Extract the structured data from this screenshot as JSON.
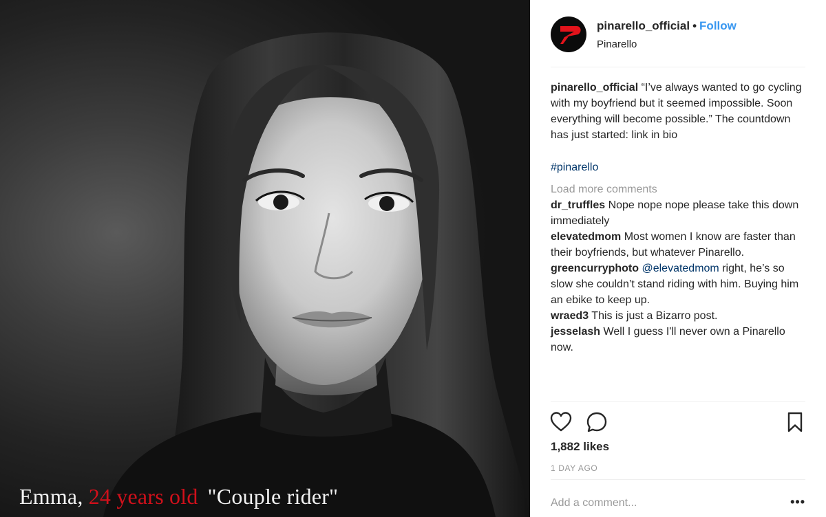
{
  "photo": {
    "caption_name": "Emma,",
    "caption_age": "24 years old",
    "caption_label": "\"Couple rider\""
  },
  "header": {
    "username": "pinarello_official",
    "dot": "•",
    "follow_label": "Follow",
    "subtitle": "Pinarello",
    "avatar_icon": "pinarello-logo-icon"
  },
  "post": {
    "author": "pinarello_official",
    "text": "“I’ve always wanted to go cycling with my boyfriend but it seemed impossible. Soon everything will become possible.” The countdown has just started: link in bio",
    "hashtag": "#pinarello"
  },
  "load_more": "Load more comments",
  "comments": [
    {
      "user": "dr_truffles",
      "text": "Nope nope nope please take this down immediately"
    },
    {
      "user": "elevatedmom",
      "text": "Most women I know are faster than their boyfriends, but whatever Pinarello."
    },
    {
      "user": "greencurryphoto",
      "mention": "@elevatedmom",
      "text": "right, he’s so slow she couldn’t stand riding with him. Buying him an ebike to keep up."
    },
    {
      "user": "wraed3",
      "text": "This is just a Bizarro post."
    },
    {
      "user": "jesselash",
      "text": "Well I guess I'll never own a Pinarello now."
    }
  ],
  "actions": {
    "like_icon": "heart-icon",
    "comment_icon": "comment-bubble-icon",
    "save_icon": "bookmark-icon"
  },
  "likes": "1,882 likes",
  "time_ago": "1 DAY AGO",
  "add_comment": {
    "placeholder": "Add a comment...",
    "more": "•••"
  },
  "colors": {
    "link_blue": "#3897f0",
    "caption_red": "#d0101b",
    "muted_gray": "#999999"
  }
}
